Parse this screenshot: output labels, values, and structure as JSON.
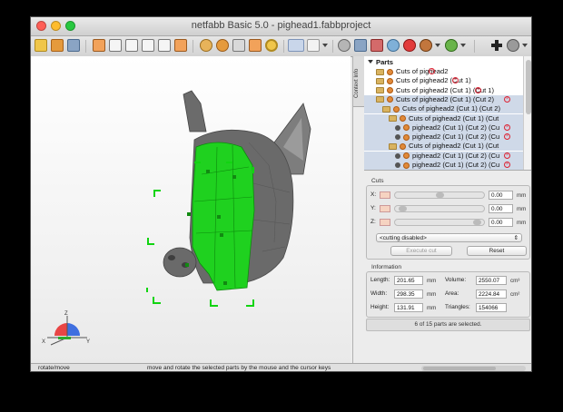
{
  "window": {
    "title": "netfabb Basic 5.0 - pighead1.fabbproject"
  },
  "colors": {
    "selection_green": "#1fd11f",
    "model_gray": "#6f6f6f",
    "close": "#ff5f57",
    "minimize": "#febc2e",
    "maximize": "#28c840"
  },
  "toolbar": {
    "icons": [
      "open-icon",
      "import-icon",
      "save-icon",
      "view-front-icon",
      "view-back-icon",
      "view-left-icon",
      "view-right-icon",
      "view-top-icon",
      "view-bottom-icon",
      "zoom-icon",
      "select-arrow-icon",
      "select-menu-icon",
      "move-icon",
      "rotate-icon",
      "scale-icon",
      "repair-icon",
      "color-icon",
      "analysis-icon",
      "add-part-icon",
      "settings-icon"
    ]
  },
  "sidebar_tab": {
    "label": "Context Info"
  },
  "parts": {
    "header": "Parts",
    "items": [
      {
        "label": "Cuts of pighead2",
        "indent": 1,
        "icon": "folder",
        "selected": false,
        "x": true
      },
      {
        "label": "Cuts of pighead2 (Cut 1)",
        "indent": 1,
        "icon": "folder",
        "selected": false,
        "x": true
      },
      {
        "label": "Cuts of pighead2 (Cut 1) (Cut 1)",
        "indent": 1,
        "icon": "folder",
        "selected": false,
        "x": true
      },
      {
        "label": "Cuts of pighead2 (Cut 1) (Cut 2)",
        "indent": 1,
        "icon": "folder",
        "selected": true,
        "x": true
      },
      {
        "label": "Cuts of pighead2 (Cut 1) (Cut 2)",
        "indent": 2,
        "icon": "folder",
        "selected": true,
        "x": false
      },
      {
        "label": "Cuts of pighead2 (Cut 1) (Cut",
        "indent": 3,
        "icon": "folder",
        "selected": true,
        "x": false
      },
      {
        "label": "pighead2 (Cut 1) (Cut 2) (Cu",
        "indent": 4,
        "icon": "dot",
        "selected": true,
        "x": true
      },
      {
        "label": "pighead2 (Cut 1) (Cut 2) (Cu",
        "indent": 4,
        "icon": "dot",
        "selected": true,
        "x": true
      },
      {
        "label": "Cuts of pighead2 (Cut 1) (Cut",
        "indent": 3,
        "icon": "folder",
        "selected": true,
        "x": false
      },
      {
        "label": "pighead2 (Cut 1) (Cut 2) (Cu",
        "indent": 4,
        "icon": "dot",
        "selected": true,
        "x": true
      },
      {
        "label": "pighead2 (Cut 1) (Cut 2) (Cu",
        "indent": 4,
        "icon": "dot",
        "selected": true,
        "x": true
      }
    ]
  },
  "cuts": {
    "title": "Cuts",
    "axes": [
      {
        "label": "X:",
        "value": "0.00",
        "unit": "mm"
      },
      {
        "label": "Y:",
        "value": "0.00",
        "unit": "mm"
      },
      {
        "label": "Z:",
        "value": "0.00",
        "unit": "mm"
      }
    ],
    "mode": "<cutting disabled>",
    "execute_label": "Execute cut",
    "reset_label": "Reset"
  },
  "information": {
    "title": "Information",
    "length_label": "Length:",
    "length_value": "201.65",
    "length_unit": "mm",
    "width_label": "Width:",
    "width_value": "298.35",
    "width_unit": "mm",
    "height_label": "Height:",
    "height_value": "131.91",
    "height_unit": "mm",
    "volume_label": "Volume:",
    "volume_value": "2550.07",
    "volume_unit": "cm³",
    "area_label": "Area:",
    "area_value": "2224.84",
    "area_unit": "cm²",
    "triangles_label": "Triangles:",
    "triangles_value": "154066"
  },
  "selection_status": "6 of 15 parts are selected.",
  "statusbar": {
    "mode": "rotate/move",
    "hint": "move and rotate the selected parts by the mouse and the cursor keys"
  },
  "axis_widget": {
    "x": "X",
    "y": "Y",
    "z": "Z"
  }
}
